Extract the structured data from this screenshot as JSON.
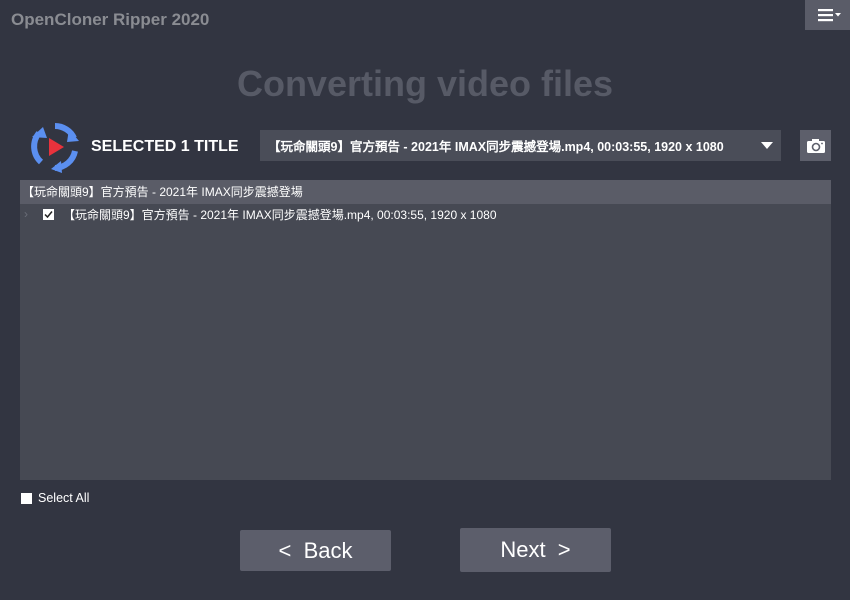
{
  "app": {
    "title": "OpenCloner Ripper 2020",
    "menu_icon": "hamburger-menu-icon"
  },
  "page": {
    "title": "Converting video files"
  },
  "selection": {
    "label": "SELECTED 1 TITLE",
    "logo_icon": "convert-cycle-play-icon",
    "dropdown_value": "【玩命關頭9】官方預告 - 2021年 IMAX同步震撼登場.mp4, 00:03:55, 1920 x 1080",
    "snapshot_icon": "camera-icon"
  },
  "tree": {
    "group_label": "【玩命關頭9】官方預告 - 2021年 IMAX同步震撼登場",
    "items": [
      {
        "label": "【玩命關頭9】官方預告 - 2021年 IMAX同步震撼登場.mp4, 00:03:55, 1920 x 1080",
        "checked": true,
        "expander": "›"
      }
    ]
  },
  "select_all": {
    "label": "Select All",
    "checked": false
  },
  "buttons": {
    "back": "<  Back",
    "next": "Next  >"
  },
  "colors": {
    "background": "#323541",
    "accent_blue": "#5b8ff0",
    "accent_red": "#e8323c"
  }
}
